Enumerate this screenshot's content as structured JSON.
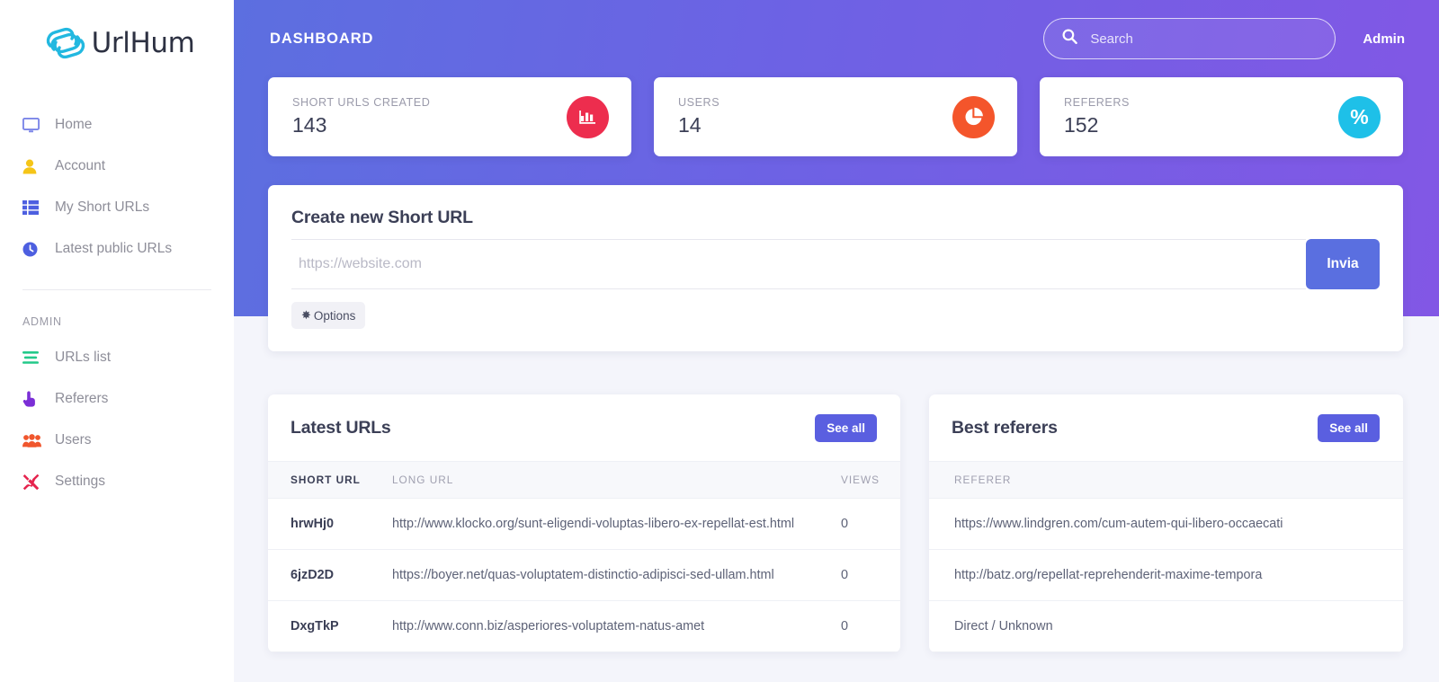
{
  "brand": {
    "name": "UrlHum",
    "logo_icon": "chain-link-icon",
    "logo_color": "#22b8e0"
  },
  "sidebar": {
    "items": [
      {
        "label": "Home",
        "icon": "monitor-icon",
        "color": "#7b85e8"
      },
      {
        "label": "Account",
        "icon": "user-icon",
        "color": "#f5c518"
      },
      {
        "label": "My Short URLs",
        "icon": "grid-list-icon",
        "color": "#4d5fe0"
      },
      {
        "label": "Latest public URLs",
        "icon": "clock-icon",
        "color": "#4d5fe0"
      }
    ],
    "section_title": "ADMIN",
    "admin_items": [
      {
        "label": "URLs list",
        "icon": "list-lines-icon",
        "color": "#23c98a"
      },
      {
        "label": "Referers",
        "icon": "hand-pointer-icon",
        "color": "#7b2fd6"
      },
      {
        "label": "Users",
        "icon": "users-group-icon",
        "color": "#f0562d"
      },
      {
        "label": "Settings",
        "icon": "tools-icon",
        "color": "#e5234d"
      }
    ]
  },
  "topbar": {
    "title": "DASHBOARD",
    "search": {
      "placeholder": "Search",
      "value": "",
      "icon": "search-icon"
    },
    "account_label": "Admin"
  },
  "stats": [
    {
      "label": "SHORT URLS CREATED",
      "value": "143",
      "icon": "bar-chart-icon",
      "color": "#ed2d4e"
    },
    {
      "label": "USERS",
      "value": "14",
      "icon": "pie-chart-icon",
      "color": "#f4552b"
    },
    {
      "label": "REFERERS",
      "value": "152",
      "icon": "percent-icon",
      "color": "#1ec0e8"
    }
  ],
  "create": {
    "title": "Create new Short URL",
    "input_placeholder": "https://website.com",
    "input_value": "",
    "submit_label": "Invia",
    "options_label": "Options",
    "options_icon": "gear-icon"
  },
  "latest_urls": {
    "title": "Latest URLs",
    "see_all_label": "See all",
    "columns": [
      "SHORT URL",
      "LONG URL",
      "VIEWS"
    ],
    "rows": [
      {
        "short": "hrwHj0",
        "long": "http://www.klocko.org/sunt-eligendi-voluptas-libero-ex-repellat-est.html",
        "views": "0"
      },
      {
        "short": "6jzD2D",
        "long": "https://boyer.net/quas-voluptatem-distinctio-adipisci-sed-ullam.html",
        "views": "0"
      },
      {
        "short": "DxgTkP",
        "long": "http://www.conn.biz/asperiores-voluptatem-natus-amet",
        "views": "0"
      }
    ]
  },
  "best_referers": {
    "title": "Best referers",
    "see_all_label": "See all",
    "columns": [
      "REFERER"
    ],
    "rows": [
      {
        "referer": "https://www.lindgren.com/cum-autem-qui-libero-occaecati",
        "is_link": true
      },
      {
        "referer": "http://batz.org/repellat-reprehenderit-maxime-tempora",
        "is_link": true
      },
      {
        "referer": "Direct / Unknown",
        "is_link": false
      }
    ]
  }
}
